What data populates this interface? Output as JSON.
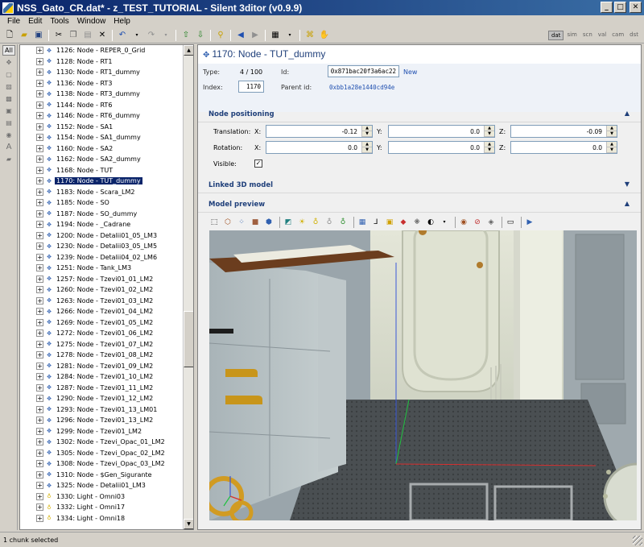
{
  "window": {
    "title": "NSS_Gato_CR.dat* - z_TEST_TUTORIAL - Silent 3ditor (v0.9.9)",
    "minimize": "_",
    "maximize": "□",
    "close": "✕"
  },
  "menu": [
    "File",
    "Edit",
    "Tools",
    "Window",
    "Help"
  ],
  "mode_tabs": [
    "dat",
    "sim",
    "scn",
    "val",
    "cam",
    "dst"
  ],
  "strip": {
    "all_label": "All"
  },
  "tree": {
    "nodes": [
      "1126: Node - REPER_0_Grid",
      "1128: Node - RT1",
      "1130: Node - RT1_dummy",
      "1136: Node - RT3",
      "1138: Node - RT3_dummy",
      "1144: Node - RT6",
      "1146: Node - RT6_dummy",
      "1152: Node - SA1",
      "1154: Node - SA1_dummy",
      "1160: Node - SA2",
      "1162: Node - SA2_dummy",
      "1168: Node - TUT",
      "1170: Node - TUT_dummy",
      "1183: Node - Scara_LM2",
      "1185: Node - SO",
      "1187: Node - SO_dummy",
      "1194: Node - _Cadrane",
      "1200: Node - Detalii01_05_LM3",
      "1230: Node - Detalii03_05_LM5",
      "1239: Node - Detalii04_02_LM6",
      "1251: Node - Tank_LM3",
      "1257: Node - Tzevi01_01_LM2",
      "1260: Node - Tzevi01_02_LM2",
      "1263: Node - Tzevi01_03_LM2",
      "1266: Node - Tzevi01_04_LM2",
      "1269: Node - Tzevi01_05_LM2",
      "1272: Node - Tzevi01_06_LM2",
      "1275: Node - Tzevi01_07_LM2",
      "1278: Node - Tzevi01_08_LM2",
      "1281: Node - Tzevi01_09_LM2",
      "1284: Node - Tzevi01_10_LM2",
      "1287: Node - Tzevi01_11_LM2",
      "1290: Node - Tzevi01_12_LM2",
      "1293: Node - Tzevi01_13_LM01",
      "1296: Node - Tzevi01_13_LM2",
      "1299: Node - Tzevi01_LM2",
      "1302: Node - Tzevi_Opac_01_LM2",
      "1305: Node - Tzevi_Opac_02_LM2",
      "1308: Node - Tzevi_Opac_03_LM2",
      "1310: Node - $Gen_Sigurante",
      "1325: Node - Detalii01_LM3",
      "1330: Light - Omni03",
      "1332: Light - Omni17",
      "1334: Light - Omni18"
    ],
    "selected_index": 12
  },
  "node": {
    "title": "1170: Node - TUT_dummy",
    "type_label": "Type:",
    "type_value": "4 / 100",
    "index_label": "Index:",
    "index_value": "1170",
    "id_label": "Id:",
    "id_value": "0x871bac20f3a6ac22",
    "new_link": "New",
    "parent_label": "Parent id:",
    "parent_value": "0xbb1a28e1440cd94e"
  },
  "positioning": {
    "section_title": "Node positioning",
    "translation_label": "Translation:",
    "rotation_label": "Rotation:",
    "visible_label": "Visible:",
    "visible_checked": "✓",
    "axis_x": "X:",
    "axis_y": "Y:",
    "axis_z": "Z:",
    "translation": {
      "x": "-0.12",
      "y": "0.0",
      "z": "-0.09"
    },
    "rotation": {
      "x": "0.0",
      "y": "0.0",
      "z": "0.0"
    }
  },
  "linked_model": {
    "section_title": "Linked 3D model"
  },
  "preview": {
    "section_title": "Model preview"
  },
  "status": {
    "text": "1 chunk selected"
  },
  "colors": {
    "title_bar": "#0a246a",
    "selection": "#0a246a",
    "section_title": "#1f3f7a",
    "link": "#2050b0"
  }
}
